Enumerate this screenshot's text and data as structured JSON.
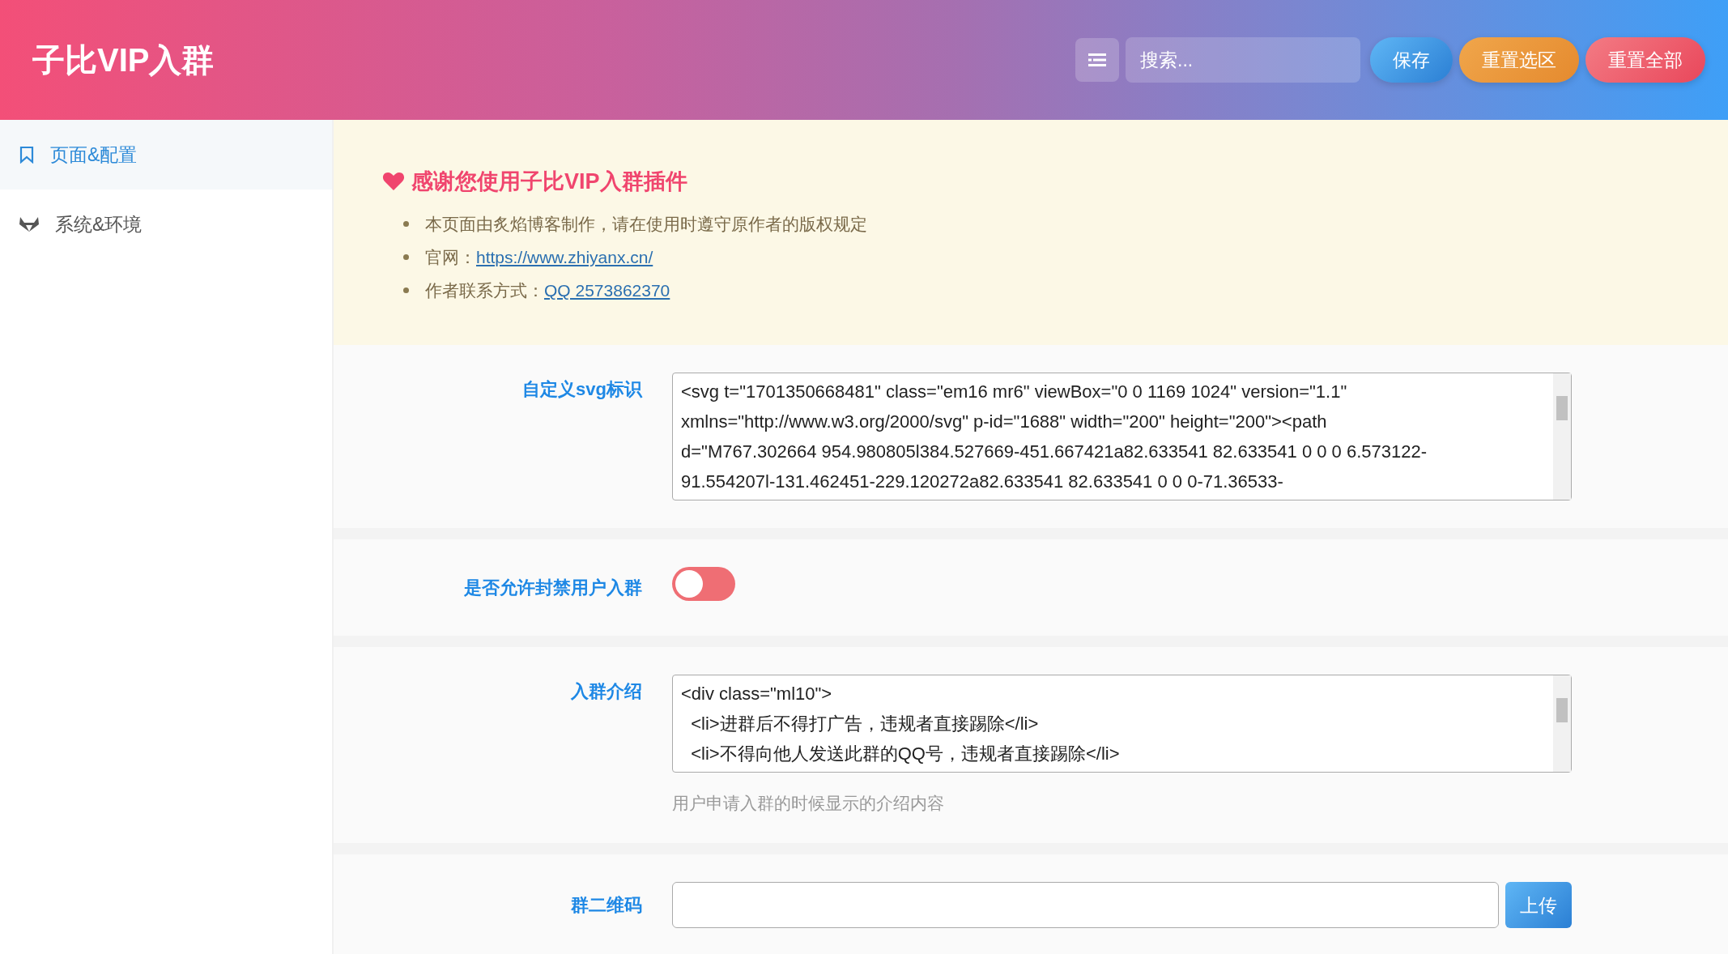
{
  "header": {
    "title": "子比VIP入群",
    "search": {
      "placeholder": "搜索..."
    },
    "buttons": [
      {
        "label": "保存",
        "kind": "save"
      },
      {
        "label": "重置选区",
        "kind": "reset-section"
      },
      {
        "label": "重置全部",
        "kind": "reset-all"
      }
    ]
  },
  "sidebar": {
    "items": [
      {
        "label": "页面&配置",
        "selected": true
      },
      {
        "label": "系统&环境",
        "selected": false
      }
    ]
  },
  "notice": {
    "title": "感谢您使用子比VIP入群插件",
    "items": [
      {
        "text": "本页面由炙焰博客制作，请在使用时遵守原作者的版权规定"
      },
      {
        "text": "官网：",
        "link": "https://www.zhiyanx.cn/"
      },
      {
        "text": "作者联系方式：",
        "link": "QQ 2573862370"
      }
    ]
  },
  "fields": [
    {
      "kind": "textarea",
      "label": "自定义svg标识",
      "lines": [
        "<svg t=\"1701350668481\" class=\"em16 mr6\" viewBox=\"0 0 1169 1024\" version=\"1.1\"",
        "xmlns=\"http://www.w3.org/2000/svg\" p-id=\"1688\" width=\"200\" height=\"200\"><path",
        "d=\"M767.302664 954.980805l384.527669-451.667421a82.633541 82.633541 0 0 0 6.573122-",
        "91.554207l-131.462451-229.120272a82.633541 82.633541 0 0 0-71.36533-"
      ]
    },
    {
      "kind": "switch",
      "label": "是否允许封禁用户入群",
      "on": false
    },
    {
      "kind": "textarea",
      "label": "入群介绍",
      "lines": [
        "<div class=\"ml10\">",
        "  <li>进群后不得打广告，违规者直接踢除</li>",
        "  <li>不得向他人发送此群的QQ号，违规者直接踢除</li>"
      ],
      "help": "用户申请入群的时候显示的介绍内容"
    },
    {
      "kind": "upload",
      "label": "群二维码",
      "button": "上传"
    }
  ]
}
